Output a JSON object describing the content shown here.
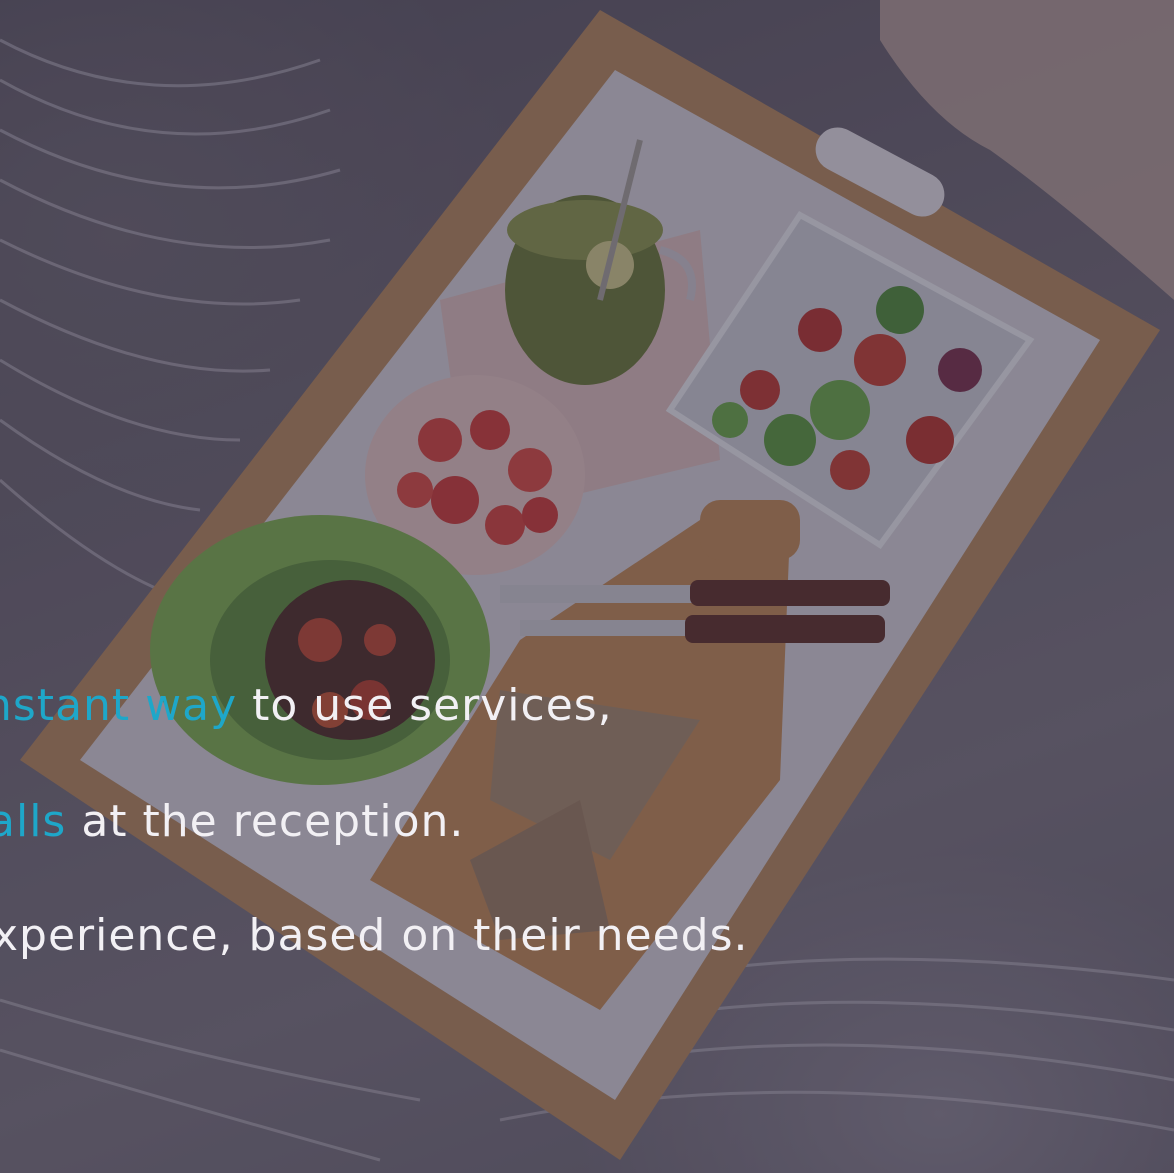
{
  "caption": {
    "line1": {
      "accent": "nstant way",
      "rest": " to use services,"
    },
    "line2": {
      "accent": "alls",
      "rest": " at the reception."
    },
    "line3": {
      "accent": "",
      "rest": "xperience, based on their needs."
    }
  },
  "colors": {
    "accent": "#1ea7c9",
    "text": "#f2f0f4",
    "overlay": "#2d283e"
  }
}
